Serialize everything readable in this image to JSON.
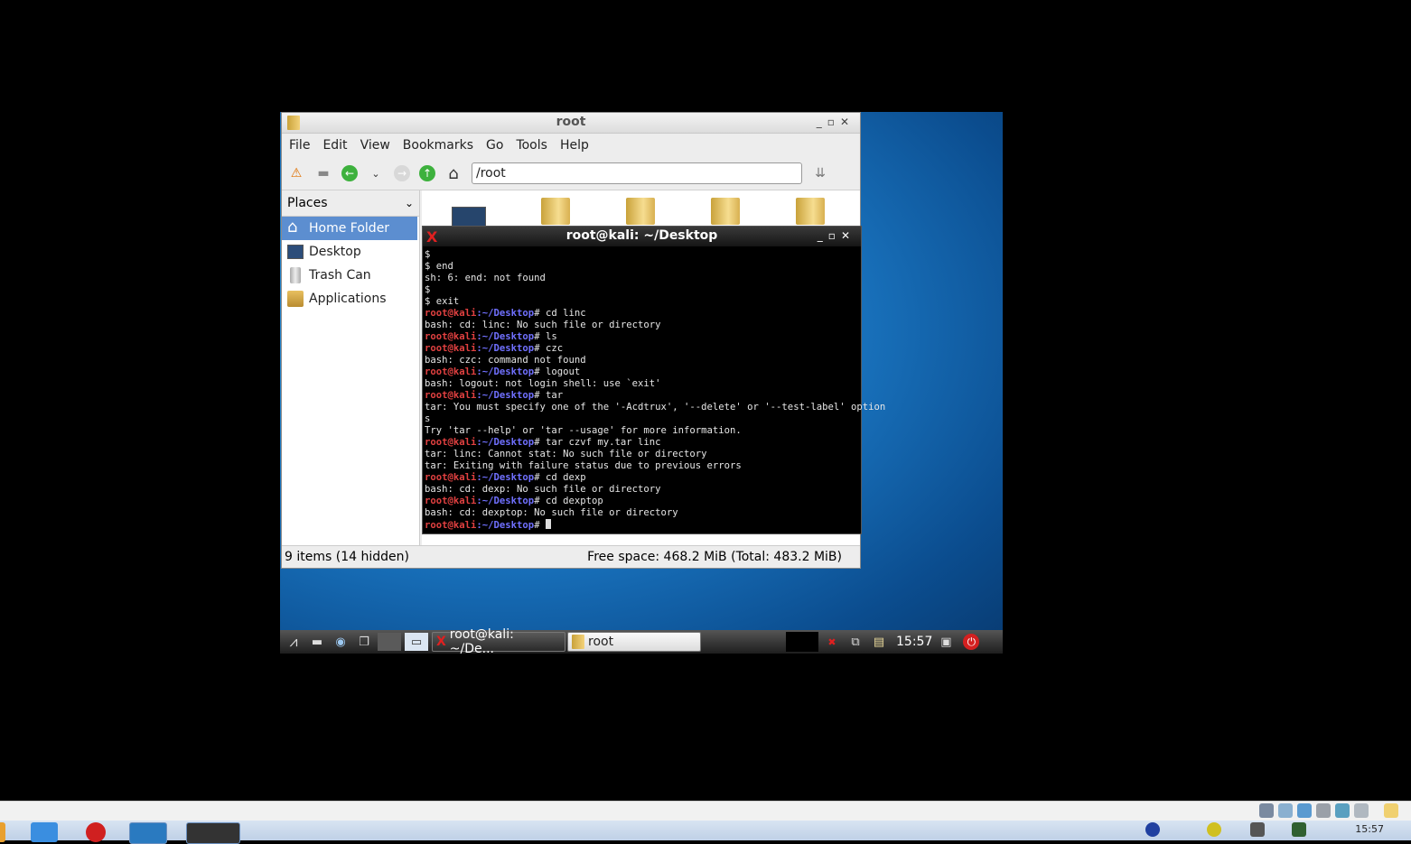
{
  "file_manager": {
    "title": "root",
    "menu": [
      "File",
      "Edit",
      "View",
      "Bookmarks",
      "Go",
      "Tools",
      "Help"
    ],
    "location": "/root",
    "places_header": "Places",
    "places": [
      "Home Folder",
      "Desktop",
      "Trash Can",
      "Applications"
    ],
    "status_items": "9 items (14 hidden)",
    "status_space": "Free space: 468.2 MiB (Total: 483.2 MiB)"
  },
  "terminal": {
    "title": "root@kali: ~/Desktop",
    "prompt_user": "root@kali",
    "prompt_path": ":~/Desktop",
    "lines": [
      {
        "t": "plain",
        "text": "$"
      },
      {
        "t": "plain",
        "text": "$ end"
      },
      {
        "t": "plain",
        "text": "sh: 6: end: not found"
      },
      {
        "t": "plain",
        "text": "$"
      },
      {
        "t": "plain",
        "text": "$ exit"
      },
      {
        "t": "cmd",
        "text": "# cd linc"
      },
      {
        "t": "plain",
        "text": "bash: cd: linc: No such file or directory"
      },
      {
        "t": "cmd",
        "text": "# ls"
      },
      {
        "t": "cmd",
        "text": "# czc"
      },
      {
        "t": "plain",
        "text": "bash: czc: command not found"
      },
      {
        "t": "cmd",
        "text": "# logout"
      },
      {
        "t": "plain",
        "text": "bash: logout: not login shell: use `exit'"
      },
      {
        "t": "cmd",
        "text": "# tar"
      },
      {
        "t": "plain",
        "text": "tar: You must specify one of the '-Acdtrux', '--delete' or '--test-label' option"
      },
      {
        "t": "plain",
        "text": "s"
      },
      {
        "t": "plain",
        "text": "Try 'tar --help' or 'tar --usage' for more information."
      },
      {
        "t": "cmd",
        "text": "# tar czvf my.tar linc"
      },
      {
        "t": "plain",
        "text": "tar: linc: Cannot stat: No such file or directory"
      },
      {
        "t": "plain",
        "text": "tar: Exiting with failure status due to previous errors"
      },
      {
        "t": "cmd",
        "text": "# cd dexp"
      },
      {
        "t": "plain",
        "text": "bash: cd: dexp: No such file or directory"
      },
      {
        "t": "cmd",
        "text": "# cd dexptop"
      },
      {
        "t": "plain",
        "text": "bash: cd: dexptop: No such file or directory"
      },
      {
        "t": "cmd",
        "text": "# "
      }
    ]
  },
  "vm_taskbar": {
    "terminal_task": "root@kali: ~/De...",
    "fm_task": "root",
    "clock": "15:57"
  },
  "host": {
    "clock": "15:57"
  }
}
